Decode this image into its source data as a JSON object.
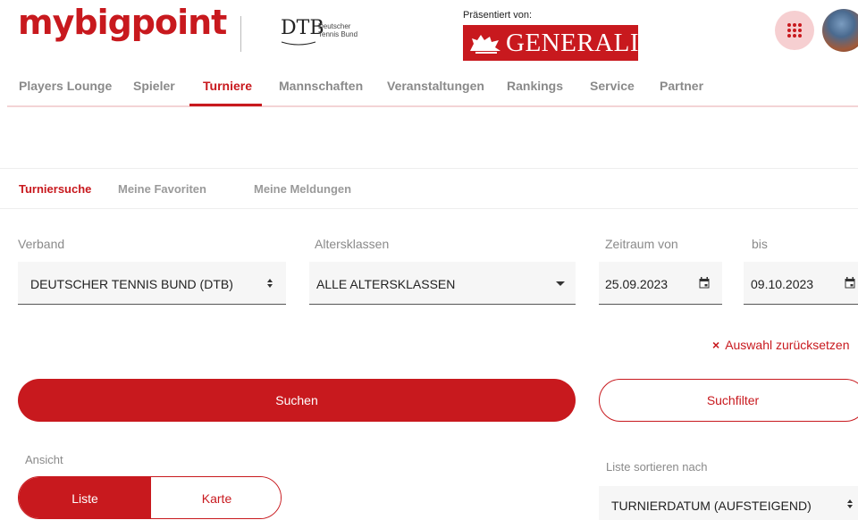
{
  "header": {
    "logo": "mybigpoint",
    "dtb_mark": "DTB",
    "dtb_text": "Deutscher\nTennis Bund",
    "presented_by": "Präsentiert von:",
    "sponsor": "GENERALI"
  },
  "nav": {
    "items": [
      {
        "label": "Players Lounge"
      },
      {
        "label": "Spieler"
      },
      {
        "label": "Turniere"
      },
      {
        "label": "Mannschaften"
      },
      {
        "label": "Veranstaltungen"
      },
      {
        "label": "Rankings"
      },
      {
        "label": "Service"
      },
      {
        "label": "Partner"
      }
    ],
    "active": "Turniere"
  },
  "subtabs": {
    "items": [
      {
        "label": "Turniersuche"
      },
      {
        "label": "Meine Favoriten"
      },
      {
        "label": "Meine Meldungen"
      }
    ],
    "active": "Turniersuche"
  },
  "filters": {
    "verband": {
      "label": "Verband",
      "value": "DEUTSCHER TENNIS BUND (DTB)"
    },
    "altersklassen": {
      "label": "Altersklassen",
      "value": "ALLE ALTERSKLASSEN"
    },
    "zeitraum_von": {
      "label": "Zeitraum von",
      "value": "25.09.2023"
    },
    "bis": {
      "label": "bis",
      "value": "09.10.2023"
    }
  },
  "actions": {
    "reset": "Auswahl zurücksetzen",
    "search": "Suchen",
    "search_filter": "Suchfilter"
  },
  "view": {
    "label": "Ansicht",
    "options": [
      {
        "label": "Liste"
      },
      {
        "label": "Karte"
      }
    ],
    "active": "Liste"
  },
  "sort": {
    "label": "Liste sortieren nach",
    "value": "TURNIERDATUM (AUFSTEIGEND)"
  },
  "colors": {
    "brand": "#c8191e",
    "muted": "#8a8a8a",
    "field_bg": "#f6f6f6"
  }
}
